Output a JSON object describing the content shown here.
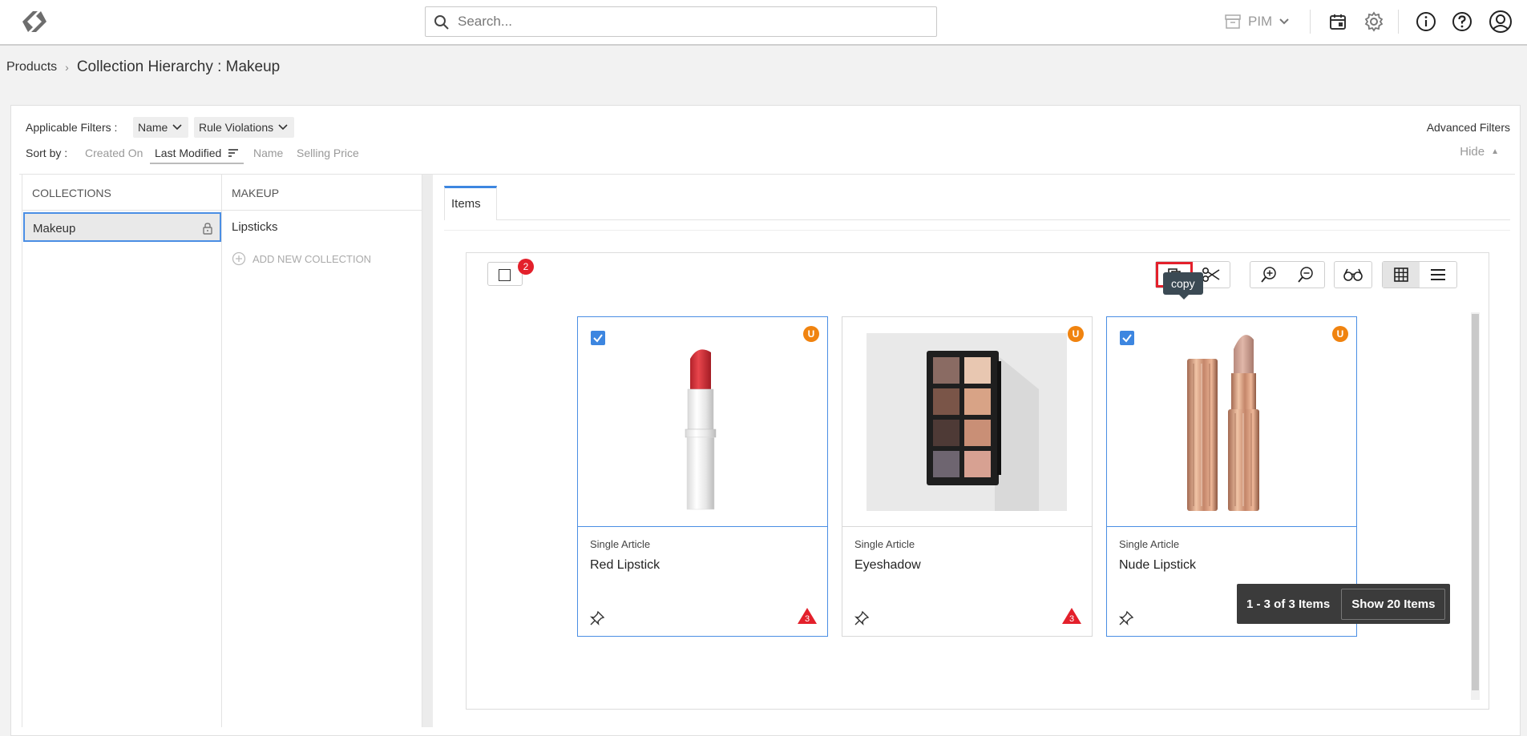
{
  "header": {
    "search_placeholder": "Search...",
    "module": "PIM"
  },
  "breadcrumb": {
    "root": "Products",
    "separator": "›",
    "title": "Collection Hierarchy : Makeup"
  },
  "filters": {
    "label": "Applicable Filters :",
    "chips": [
      "Name",
      "Rule Violations"
    ],
    "advanced": "Advanced Filters",
    "sort_label": "Sort by :",
    "sort_options": [
      "Created On",
      "Last Modified",
      "Name",
      "Selling Price"
    ],
    "sort_active": "Last Modified",
    "hide": "Hide",
    "hide_arrow": "▲"
  },
  "collections": {
    "header": "COLLECTIONS",
    "items": [
      "Makeup"
    ]
  },
  "makeup": {
    "header": "MAKEUP",
    "items": [
      "Lipsticks"
    ],
    "add_new": "ADD NEW COLLECTION"
  },
  "tabs": [
    "Items"
  ],
  "toolbar": {
    "selected_count": "2",
    "tooltip": "copy",
    "icons": [
      "copy-icon",
      "scissors-icon",
      "zoom-in-icon",
      "zoom-out-icon",
      "glasses-icon",
      "grid-view-icon",
      "list-view-icon"
    ]
  },
  "cards": [
    {
      "type": "Single Article",
      "name": "Red Lipstick",
      "selected": true,
      "badge": "U",
      "warnings": "3"
    },
    {
      "type": "Single Article",
      "name": "Eyeshadow",
      "selected": false,
      "badge": "U",
      "warnings": "3"
    },
    {
      "type": "Single Article",
      "name": "Nude Lipstick",
      "selected": true,
      "badge": "U",
      "warnings": "3"
    }
  ],
  "pager": {
    "range": "1 - 3 of 3 Items",
    "show": "Show 20 Items"
  },
  "colors": {
    "accent": "#3d86e0",
    "badge_red": "#e3202b",
    "badge_orange": "#f0830f"
  }
}
